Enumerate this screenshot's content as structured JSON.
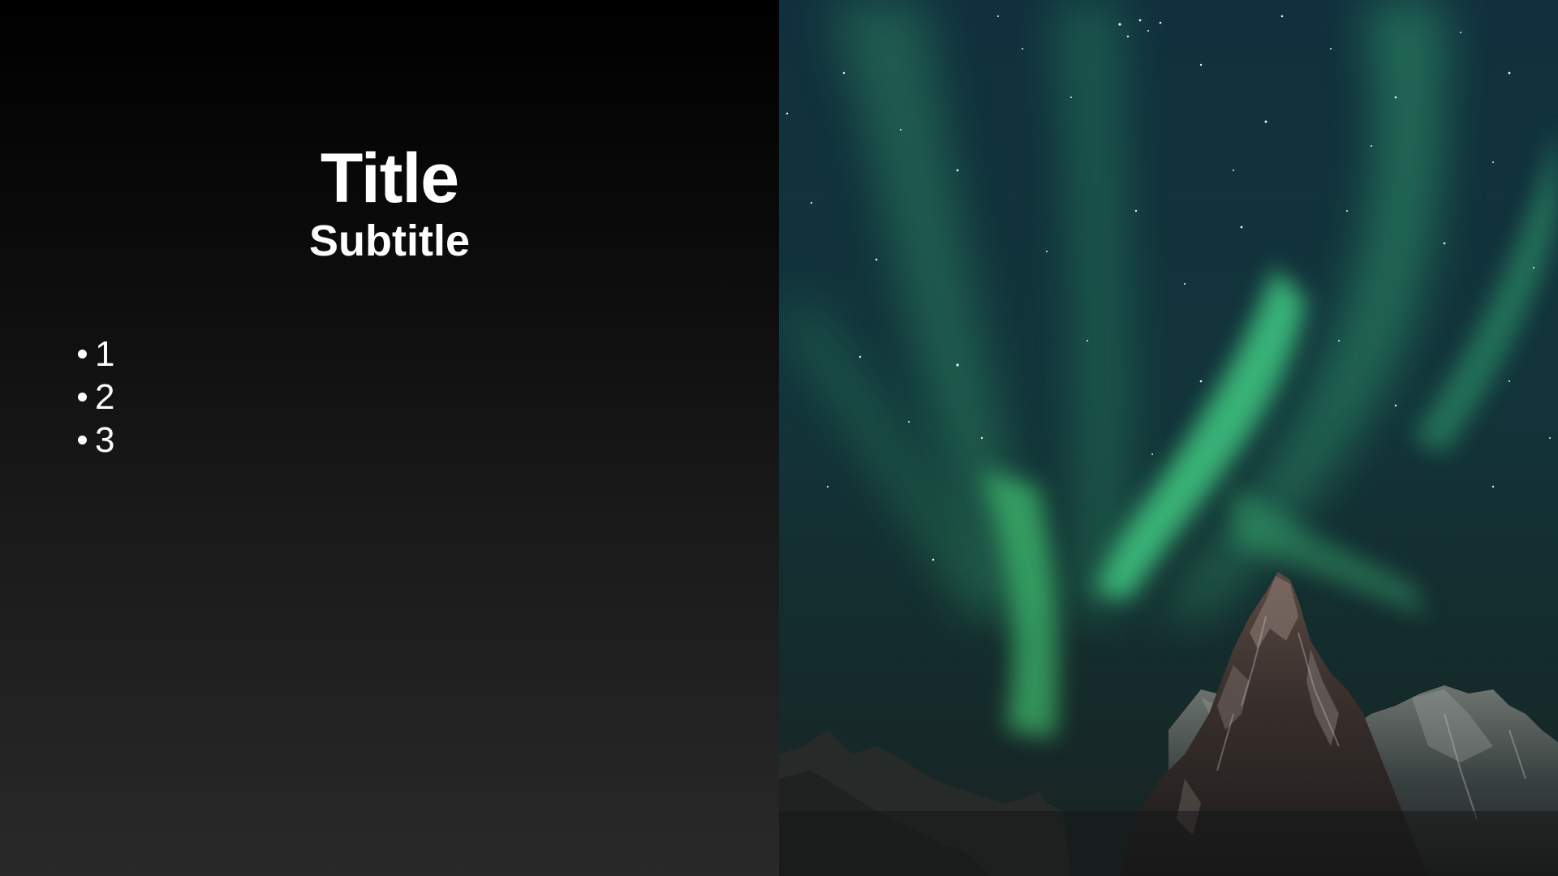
{
  "slide": {
    "title": "Title",
    "subtitle": "Subtitle",
    "bullets": [
      "1",
      "2",
      "3"
    ]
  },
  "colors": {
    "text": "#ffffff",
    "gradient_top": "#000000",
    "gradient_bottom": "#292929",
    "aurora": "#3dd67a",
    "sky": "#0f2c38"
  },
  "image": {
    "subject": "aurora-borealis-over-mountain"
  }
}
